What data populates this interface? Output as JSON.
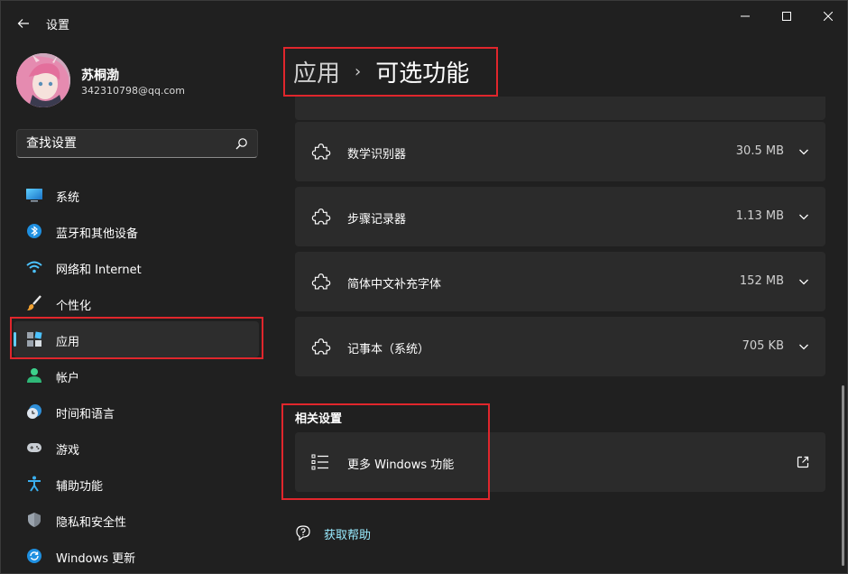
{
  "window": {
    "title": "设置",
    "back_label": "←"
  },
  "profile": {
    "name": "苏桐渤",
    "email": "342310798@qq.com"
  },
  "search": {
    "placeholder": "查找设置"
  },
  "sidebar": {
    "items": [
      {
        "label": "系统",
        "icon": "monitor-icon",
        "active": false
      },
      {
        "label": "蓝牙和其他设备",
        "icon": "bluetooth-icon",
        "active": false
      },
      {
        "label": "网络和 Internet",
        "icon": "wifi-icon",
        "active": false
      },
      {
        "label": "个性化",
        "icon": "paintbrush-icon",
        "active": false
      },
      {
        "label": "应用",
        "icon": "apps-icon",
        "active": true
      },
      {
        "label": "帐户",
        "icon": "person-icon",
        "active": false
      },
      {
        "label": "时间和语言",
        "icon": "clock-globe-icon",
        "active": false
      },
      {
        "label": "游戏",
        "icon": "gamepad-icon",
        "active": false
      },
      {
        "label": "辅助功能",
        "icon": "accessibility-icon",
        "active": false
      },
      {
        "label": "隐私和安全性",
        "icon": "shield-icon",
        "active": false
      },
      {
        "label": "Windows 更新",
        "icon": "update-icon",
        "active": false
      }
    ]
  },
  "breadcrumb": {
    "parent": "应用",
    "separator": "›",
    "current": "可选功能"
  },
  "features": [
    {
      "name": "数学识别器",
      "size": "30.5 MB"
    },
    {
      "name": "步骤记录器",
      "size": "1.13 MB"
    },
    {
      "name": "简体中文补充字体",
      "size": "152 MB"
    },
    {
      "name": "记事本（系统）",
      "size": "705 KB"
    }
  ],
  "related": {
    "title": "相关设置",
    "more_windows_features": "更多 Windows 功能"
  },
  "help": {
    "label": "获取帮助"
  },
  "colors": {
    "background": "#202020",
    "card": "#2b2b2b",
    "accent": "#60cdff",
    "link": "#99ebff",
    "highlight_box": "#e0262c"
  }
}
